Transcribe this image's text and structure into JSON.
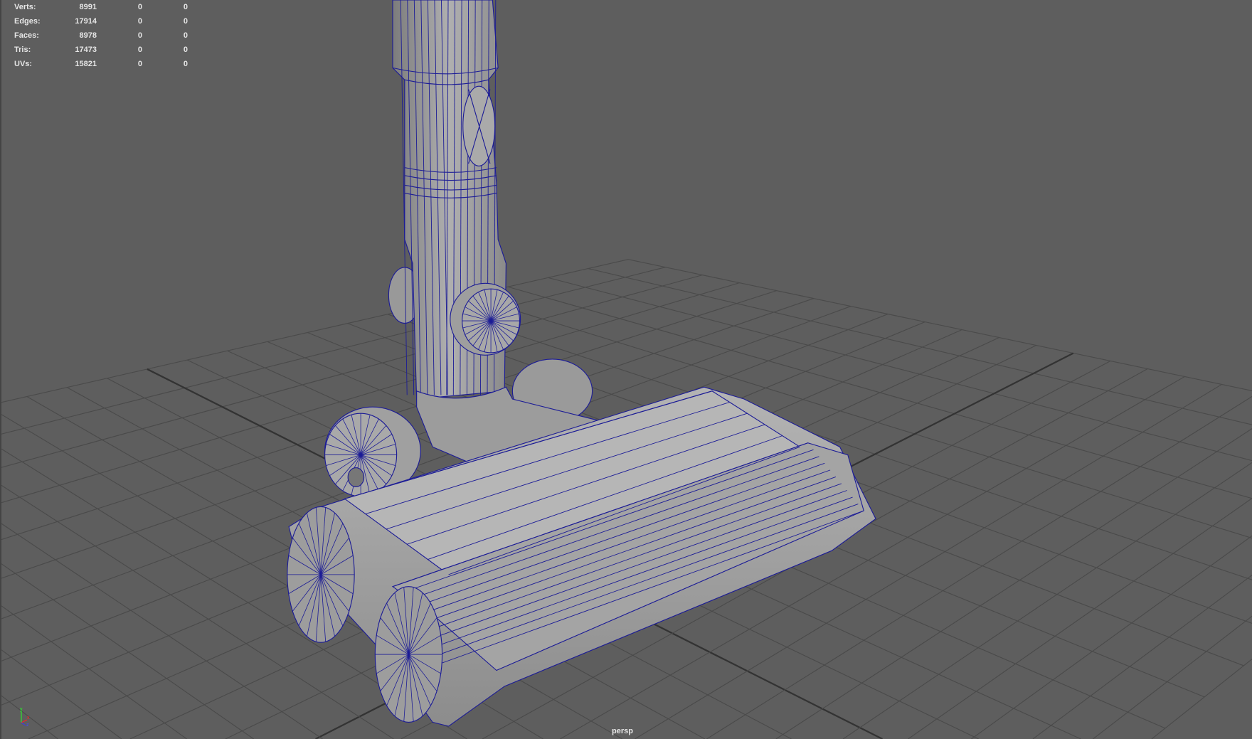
{
  "stats": [
    {
      "label": "Verts:",
      "value": "8991",
      "selected": "0",
      "components": "0"
    },
    {
      "label": "Edges:",
      "value": "17914",
      "selected": "0",
      "components": "0"
    },
    {
      "label": "Faces:",
      "value": "8978",
      "selected": "0",
      "components": "0"
    },
    {
      "label": "Tris:",
      "value": "17473",
      "selected": "0",
      "components": "0"
    },
    {
      "label": "UVs:",
      "value": "15821",
      "selected": "0",
      "components": "0"
    }
  ],
  "camera_label": "persp",
  "axis_labels": {
    "x": "x",
    "y": "y",
    "z": "z"
  },
  "colors": {
    "background": "#5e5e5e",
    "grid": "#4a4a4a",
    "wire": "#1c1c96",
    "mesh": "#a0a0a0"
  }
}
